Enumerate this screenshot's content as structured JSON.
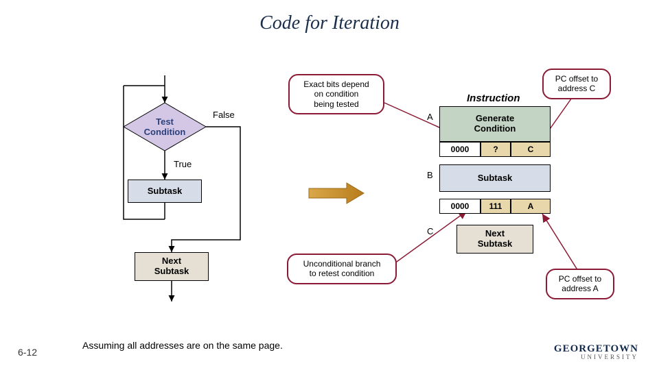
{
  "title": "Code for Iteration",
  "flowchart": {
    "test_condition": "Test\nCondition",
    "false_label": "False",
    "true_label": "True",
    "subtask": "Subtask",
    "next_subtask": "Next\nSubtask"
  },
  "annotations": {
    "exact_bits": "Exact bits depend\non condition\nbeing tested",
    "pc_offset_c": "PC offset to\naddress C",
    "uncond_branch": "Unconditional branch\nto retest condition",
    "pc_offset_a": "PC offset to\naddress A"
  },
  "right": {
    "instruction_label": "Instruction",
    "A": "A",
    "B": "B",
    "C": "C",
    "generate_condition": "Generate\nCondition",
    "row1": {
      "c1": "0000",
      "c2": "?",
      "c3": "C"
    },
    "subtask": "Subtask",
    "row2": {
      "c1": "0000",
      "c2": "111",
      "c3": "A"
    },
    "next_subtask": "Next\nSubtask"
  },
  "footer": {
    "slide_num": "6-12",
    "note": "Assuming all addresses are on the same page.",
    "logo1": "GEORGETOWN",
    "logo2": "UNIVERSITY"
  }
}
